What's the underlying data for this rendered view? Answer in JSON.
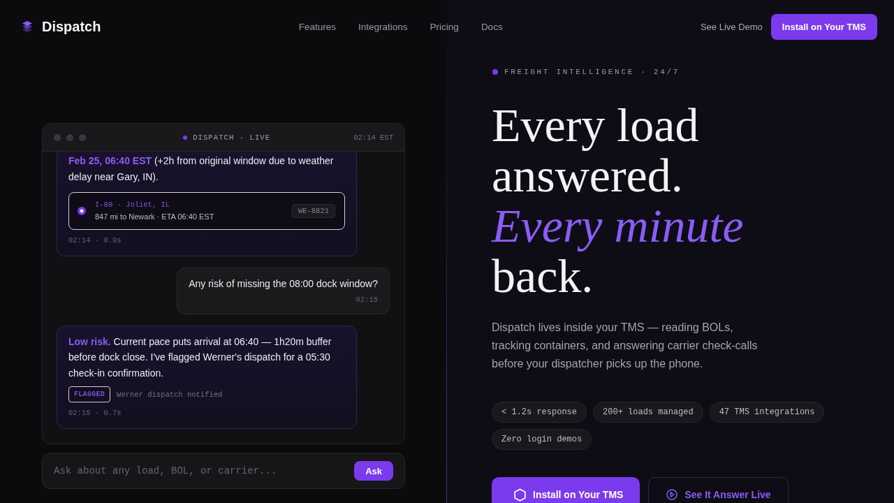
{
  "header": {
    "brand": "Dispatch",
    "nav": [
      {
        "label": "Features"
      },
      {
        "label": "Integrations"
      },
      {
        "label": "Pricing"
      },
      {
        "label": "Docs"
      }
    ],
    "demo_link": "See Live Demo",
    "install_button": "Install on Your TMS"
  },
  "chat_window": {
    "title": "DISPATCH · LIVE",
    "time": "02:14 EST",
    "messages": [
      {
        "kind": "bot",
        "text": "**Feb 25, 06:40 EST** (+2h from original window due to weather delay near Gary, IN).",
        "load": {
          "route": "I-80 · Joliet, IL",
          "detail": "847 mi to Newark · ETA 06:40 EST",
          "tag": "WE-8821"
        },
        "meta": "02:14 · 0.9s"
      },
      {
        "kind": "user",
        "text": "Any risk of missing the 08:00 dock window?",
        "meta": "02:15"
      },
      {
        "kind": "bot",
        "text": "**Low risk.** Current pace puts arrival at 06:40 — 1h20m buffer before dock close. I've flagged Werner's dispatch for a 05:30 check-in confirmation.",
        "flag": {
          "badge": "FLAGGED",
          "note": "Werner dispatch notified"
        },
        "meta": "02:15 · 0.7s"
      }
    ]
  },
  "ask_bar": {
    "placeholder": "Ask about any load, BOL, or carrier...",
    "button": "Ask"
  },
  "hero": {
    "eyebrow": "FREIGHT INTELLIGENCE · 24/7",
    "headline": "Every load answered. *Every minute* back.",
    "description": "Dispatch lives inside your TMS — reading BOLs, tracking containers, and answering carrier check-calls before your dispatcher picks up the phone.",
    "chips": [
      "< 1.2s response",
      "200+ loads managed",
      "47 TMS integrations",
      "Zero login demos"
    ],
    "buttons": [
      {
        "kind": "primary",
        "label": "Install on Your TMS"
      },
      {
        "kind": "secondary",
        "label": "See It Answer Live"
      }
    ]
  }
}
